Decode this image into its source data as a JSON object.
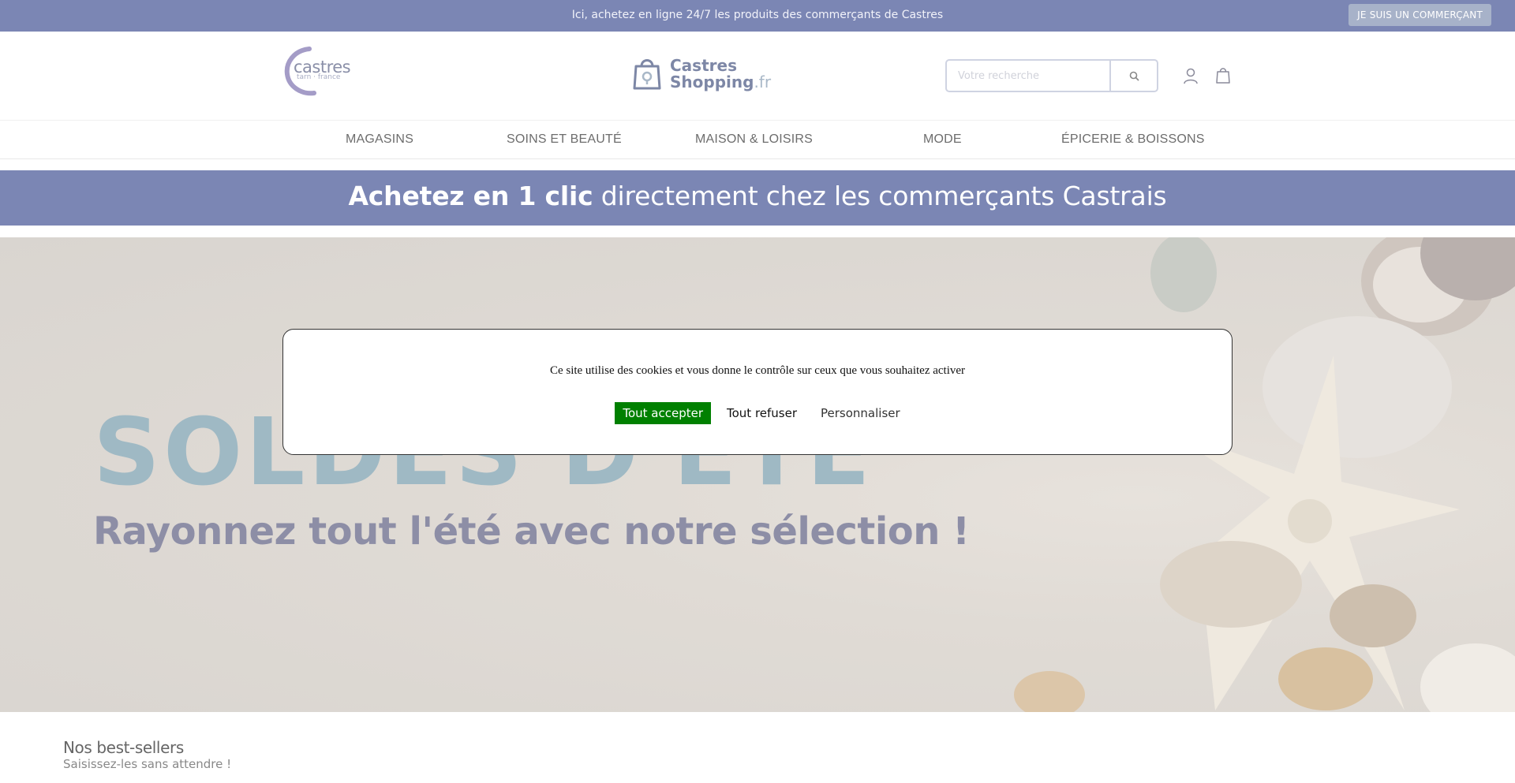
{
  "topbar": {
    "text": "Ici, achetez en ligne 24/7 les produits des commerçants de Castres",
    "merchant_button": "JE SUIS UN COMMERÇANT"
  },
  "header": {
    "logo_castres": {
      "name": "castres",
      "sub": "tarn · france"
    },
    "logo_shop": {
      "line1": "Castres",
      "line2": "Shopping",
      "tld": ".fr"
    },
    "search": {
      "placeholder": "Votre recherche",
      "value": ""
    }
  },
  "nav": {
    "items": [
      {
        "label": "MAGASINS"
      },
      {
        "label": "SOINS ET BEAUTÉ "
      },
      {
        "label": "MAISON & LOISIRS "
      },
      {
        "label": "MODE "
      },
      {
        "label": "ÉPICERIE & BOISSONS "
      }
    ]
  },
  "promo": {
    "bold": "Achetez en 1 clic",
    "rest": " directement chez les commerçants Castrais"
  },
  "hero": {
    "title": "SOLDES D'ÉTÉ",
    "subtitle": "Rayonnez tout l'été avec notre sélection !"
  },
  "cookie": {
    "message": "Ce site utilise des cookies et vous donne le contrôle sur ceux que vous souhaitez activer",
    "accept": "Tout accepter",
    "refuse": "Tout refuser",
    "customize": "Personnaliser"
  },
  "bestsellers": {
    "title": "Nos best-sellers",
    "subtitle": "Saisissez-les sans attendre ! "
  },
  "colors": {
    "brand": "#7b86b4",
    "accept_green": "#008000"
  },
  "icons": [
    "user-icon",
    "bag-icon",
    "search-icon"
  ]
}
